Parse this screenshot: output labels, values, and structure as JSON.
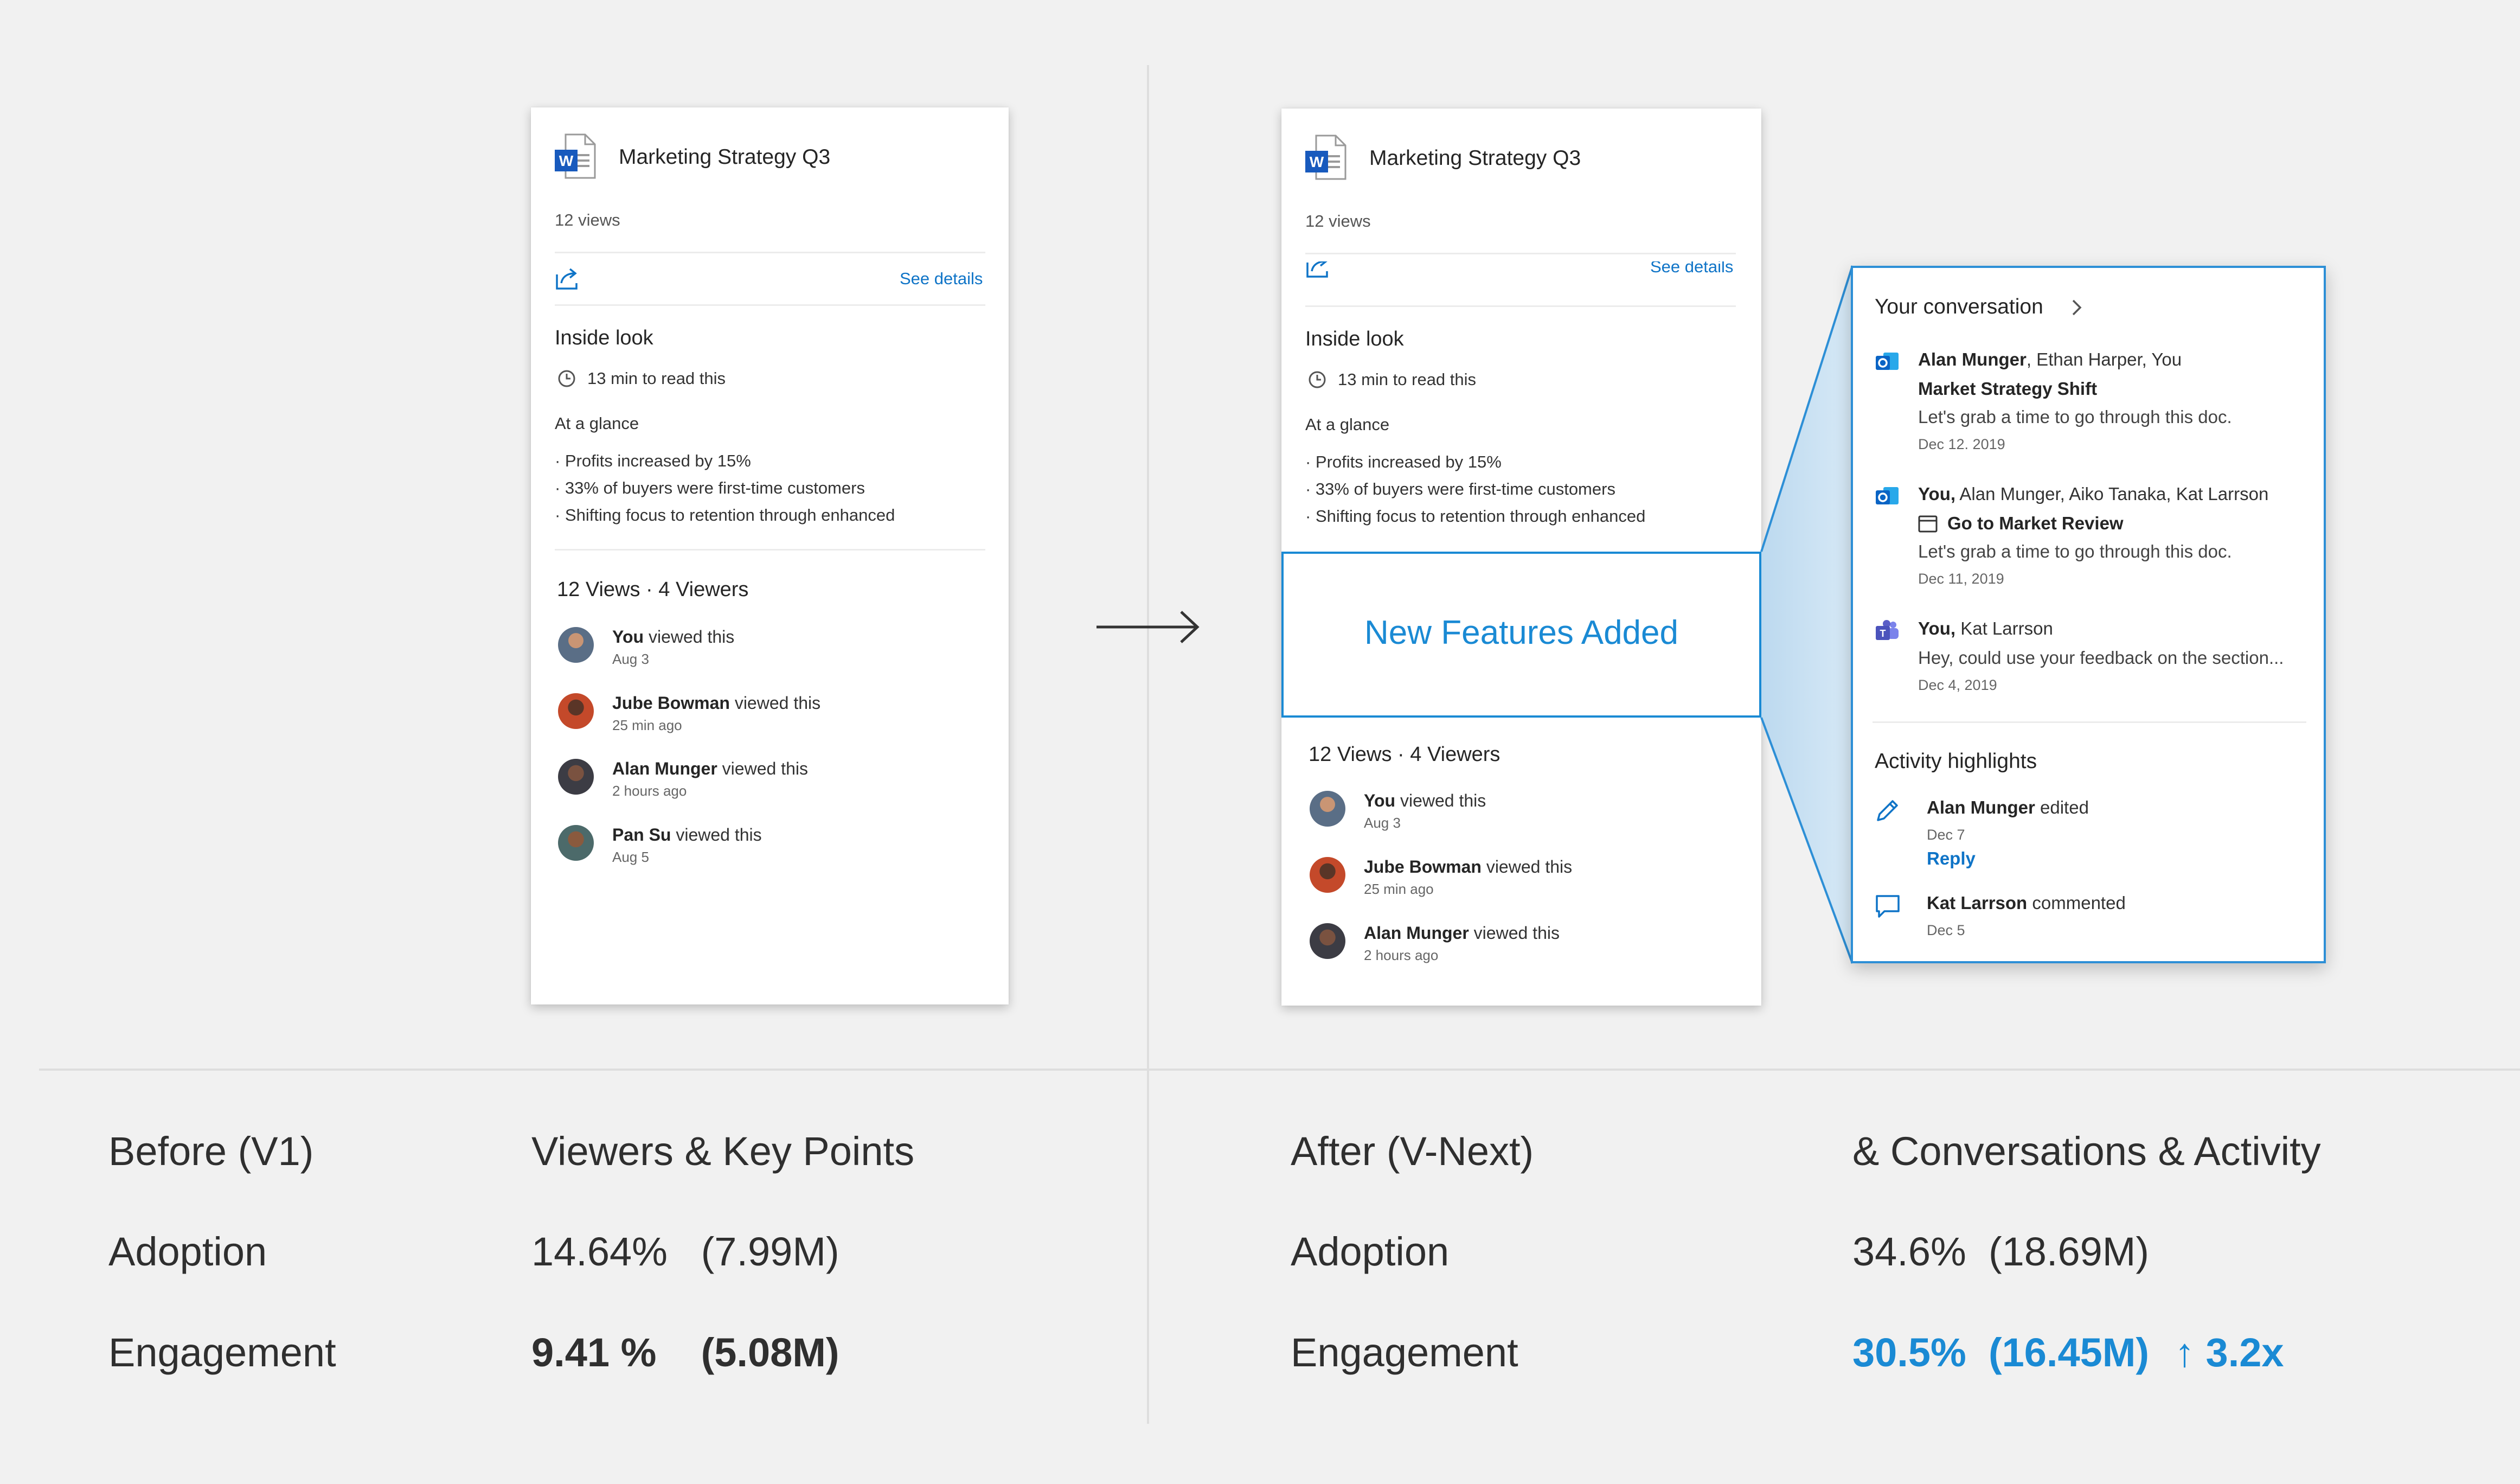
{
  "before_card": {
    "title": "Marketing Strategy Q3",
    "views": "12 views",
    "see_details": "See details",
    "inside_look": "Inside look",
    "read_time": "13 min to read this",
    "at_a_glance": "At a glance",
    "bullets": [
      "· Profits increased by 15%",
      "· 33% of buyers were first-time customers",
      "· Shifting focus to retention through enhanced"
    ],
    "viewers_heading": "12 Views · 4 Viewers",
    "viewers": [
      {
        "name": "You",
        "action": " viewed this",
        "time": "Aug 3"
      },
      {
        "name": "Jube Bowman",
        "action": " viewed this",
        "time": "25 min ago"
      },
      {
        "name": "Alan Munger",
        "action": " viewed this",
        "time": "2 hours ago"
      },
      {
        "name": "Pan Su",
        "action": " viewed this",
        "time": "Aug 5"
      }
    ]
  },
  "after_card": {
    "title": "Marketing Strategy Q3",
    "views": "12 views",
    "see_details": "See details",
    "inside_look": "Inside look",
    "read_time": "13 min to read this",
    "at_a_glance": "At a glance",
    "bullets": [
      "· Profits increased by 15%",
      "· 33% of buyers were first-time customers",
      "· Shifting focus to retention through enhanced"
    ],
    "new_features": "New Features Added",
    "viewers_heading": "12 Views · 4 Viewers",
    "viewers": [
      {
        "name": "You",
        "action": " viewed this",
        "time": "Aug 3"
      },
      {
        "name": "Jube Bowman",
        "action": " viewed this",
        "time": "25 min ago"
      },
      {
        "name": "Alan Munger",
        "action": " viewed this",
        "time": "2 hours ago"
      }
    ]
  },
  "panel": {
    "conversation_title": "Your conversation",
    "conversations": [
      {
        "lead": "Alan Munger",
        "others": ", Ethan Harper, You",
        "subject": "Market Strategy Shift",
        "message": "Let's grab a time to go through this doc.",
        "date": "Dec 12. 2019",
        "icon": "outlook-icon"
      },
      {
        "lead": "You,",
        "others": " Alan Munger, Aiko Tanaka, Kat Larrson",
        "subject": "Go to Market Review",
        "message": "Let's grab a time to go through this doc.",
        "date": "Dec 11, 2019",
        "icon": "outlook-icon"
      },
      {
        "lead": "You,",
        "others": " Kat Larrson",
        "subject": "",
        "message": "Hey, could use your feedback on the section...",
        "date": "Dec 4, 2019",
        "icon": "teams-icon"
      }
    ],
    "activity_title": "Activity highlights",
    "activities": [
      {
        "name": "Alan Munger",
        "action": " edited",
        "date": "Dec 7",
        "reply": "Reply",
        "icon": "pencil-icon"
      },
      {
        "name": "Kat Larrson",
        "action": " commented",
        "date": "Dec 5",
        "icon": "comment-icon"
      }
    ]
  },
  "metrics": {
    "before_label": "Before (V1)",
    "before_feature": "Viewers & Key Points",
    "after_label": "After (V-Next)",
    "after_feature": "& Conversations & Activity",
    "adoption_label": "Adoption",
    "engagement_label": "Engagement",
    "before_adoption": "14.64%   (7.99M)",
    "before_engagement": "9.41 %    (5.08M)",
    "after_adoption": "34.6%  (18.69M)",
    "after_engagement": "30.5%  (16.45M)",
    "after_multiplier": "↑ 3.2x"
  },
  "colors": {
    "accent": "#1a8ad4",
    "link": "#0f74c7",
    "background": "#f1f1f1",
    "word_blue": "#185abd",
    "teams_purple": "#5b5fc7"
  }
}
